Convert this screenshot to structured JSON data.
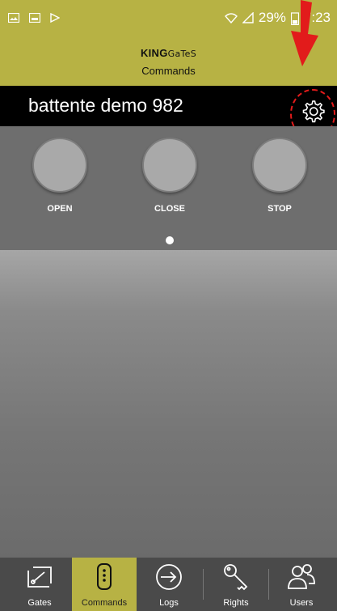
{
  "status_bar": {
    "battery": "29%",
    "time": "7:23"
  },
  "app": {
    "brand_bold": "KING",
    "brand_light": "GaTeS",
    "page_title": "Commands"
  },
  "gate": {
    "name": "battente demo 982"
  },
  "commands": [
    {
      "label": "OPEN"
    },
    {
      "label": "CLOSE"
    },
    {
      "label": "STOP"
    }
  ],
  "tabs": [
    {
      "label": "Gates",
      "icon": "gates-icon"
    },
    {
      "label": "Commands",
      "icon": "remote-icon",
      "active": true
    },
    {
      "label": "Logs",
      "icon": "logs-icon"
    },
    {
      "label": "Rights",
      "icon": "key-icon"
    },
    {
      "label": "Users",
      "icon": "users-icon"
    }
  ],
  "colors": {
    "accent": "#b7b244",
    "annotation": "#e21b1b"
  }
}
